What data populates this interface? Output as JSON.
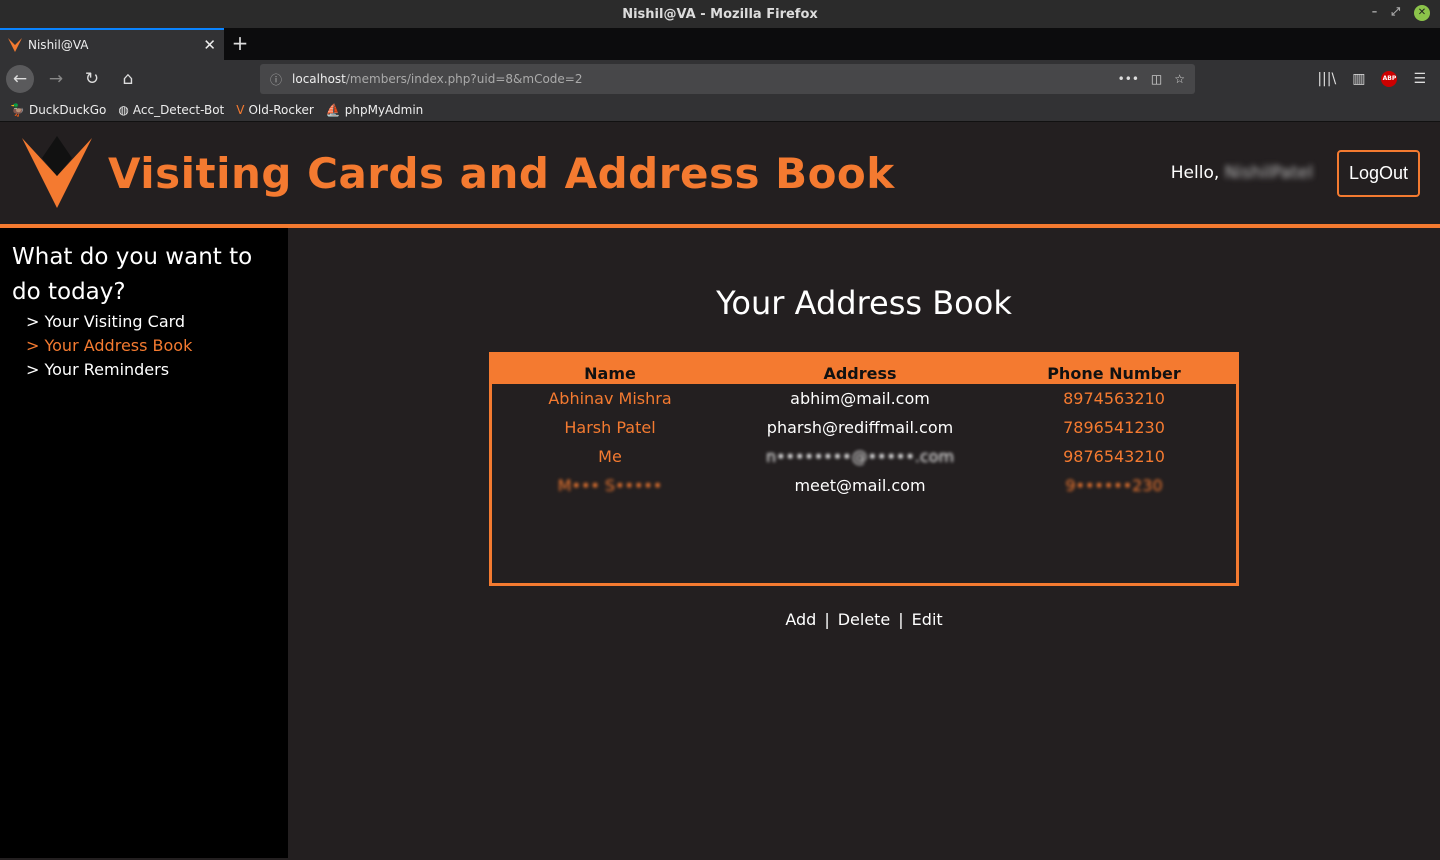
{
  "browser": {
    "window_title": "Nishil@VA - Mozilla Firefox",
    "tab_title": "Nishil@VA",
    "url_host": "localhost",
    "url_path": "/members/index.php?uid=8&mCode=2",
    "bookmarks": [
      {
        "label": "DuckDuckGo",
        "icon": "duckduckgo-icon"
      },
      {
        "label": "Acc_Detect-Bot",
        "icon": "globe-icon"
      },
      {
        "label": "Old-Rocker",
        "icon": "va-logo-icon"
      },
      {
        "label": "phpMyAdmin",
        "icon": "phpmyadmin-icon"
      }
    ]
  },
  "colors": {
    "accent": "#f47a30",
    "background": "#231f20",
    "sidebar": "#000000"
  },
  "header": {
    "title": "Visiting Cards and Address Book",
    "hello": "Hello,",
    "username": "NishilPatel",
    "logout": "LogOut"
  },
  "sidebar": {
    "heading": "What do you want to do today?",
    "items": [
      {
        "label": "> Your Visiting Card",
        "active": false
      },
      {
        "label": "> Your Address Book",
        "active": true
      },
      {
        "label": "> Your Reminders",
        "active": false
      }
    ]
  },
  "main": {
    "title": "Your Address Book",
    "columns": [
      "Name",
      "Address",
      "Phone Number"
    ],
    "rows": [
      {
        "name": "Abhinav Mishra",
        "address": "abhim@mail.com",
        "phone": "8974563210",
        "blurred": false
      },
      {
        "name": "Harsh Patel",
        "address": "pharsh@rediffmail.com",
        "phone": "7896541230",
        "blurred": false
      },
      {
        "name": "Me",
        "address": "n••••••••@•••••.com",
        "phone": "9876543210",
        "blurred": true
      },
      {
        "name": "M••• S•••••",
        "address": "meet@mail.com",
        "phone": "9••••••230",
        "blurred": true
      }
    ],
    "actions": [
      "Add",
      "Delete",
      "Edit"
    ]
  }
}
